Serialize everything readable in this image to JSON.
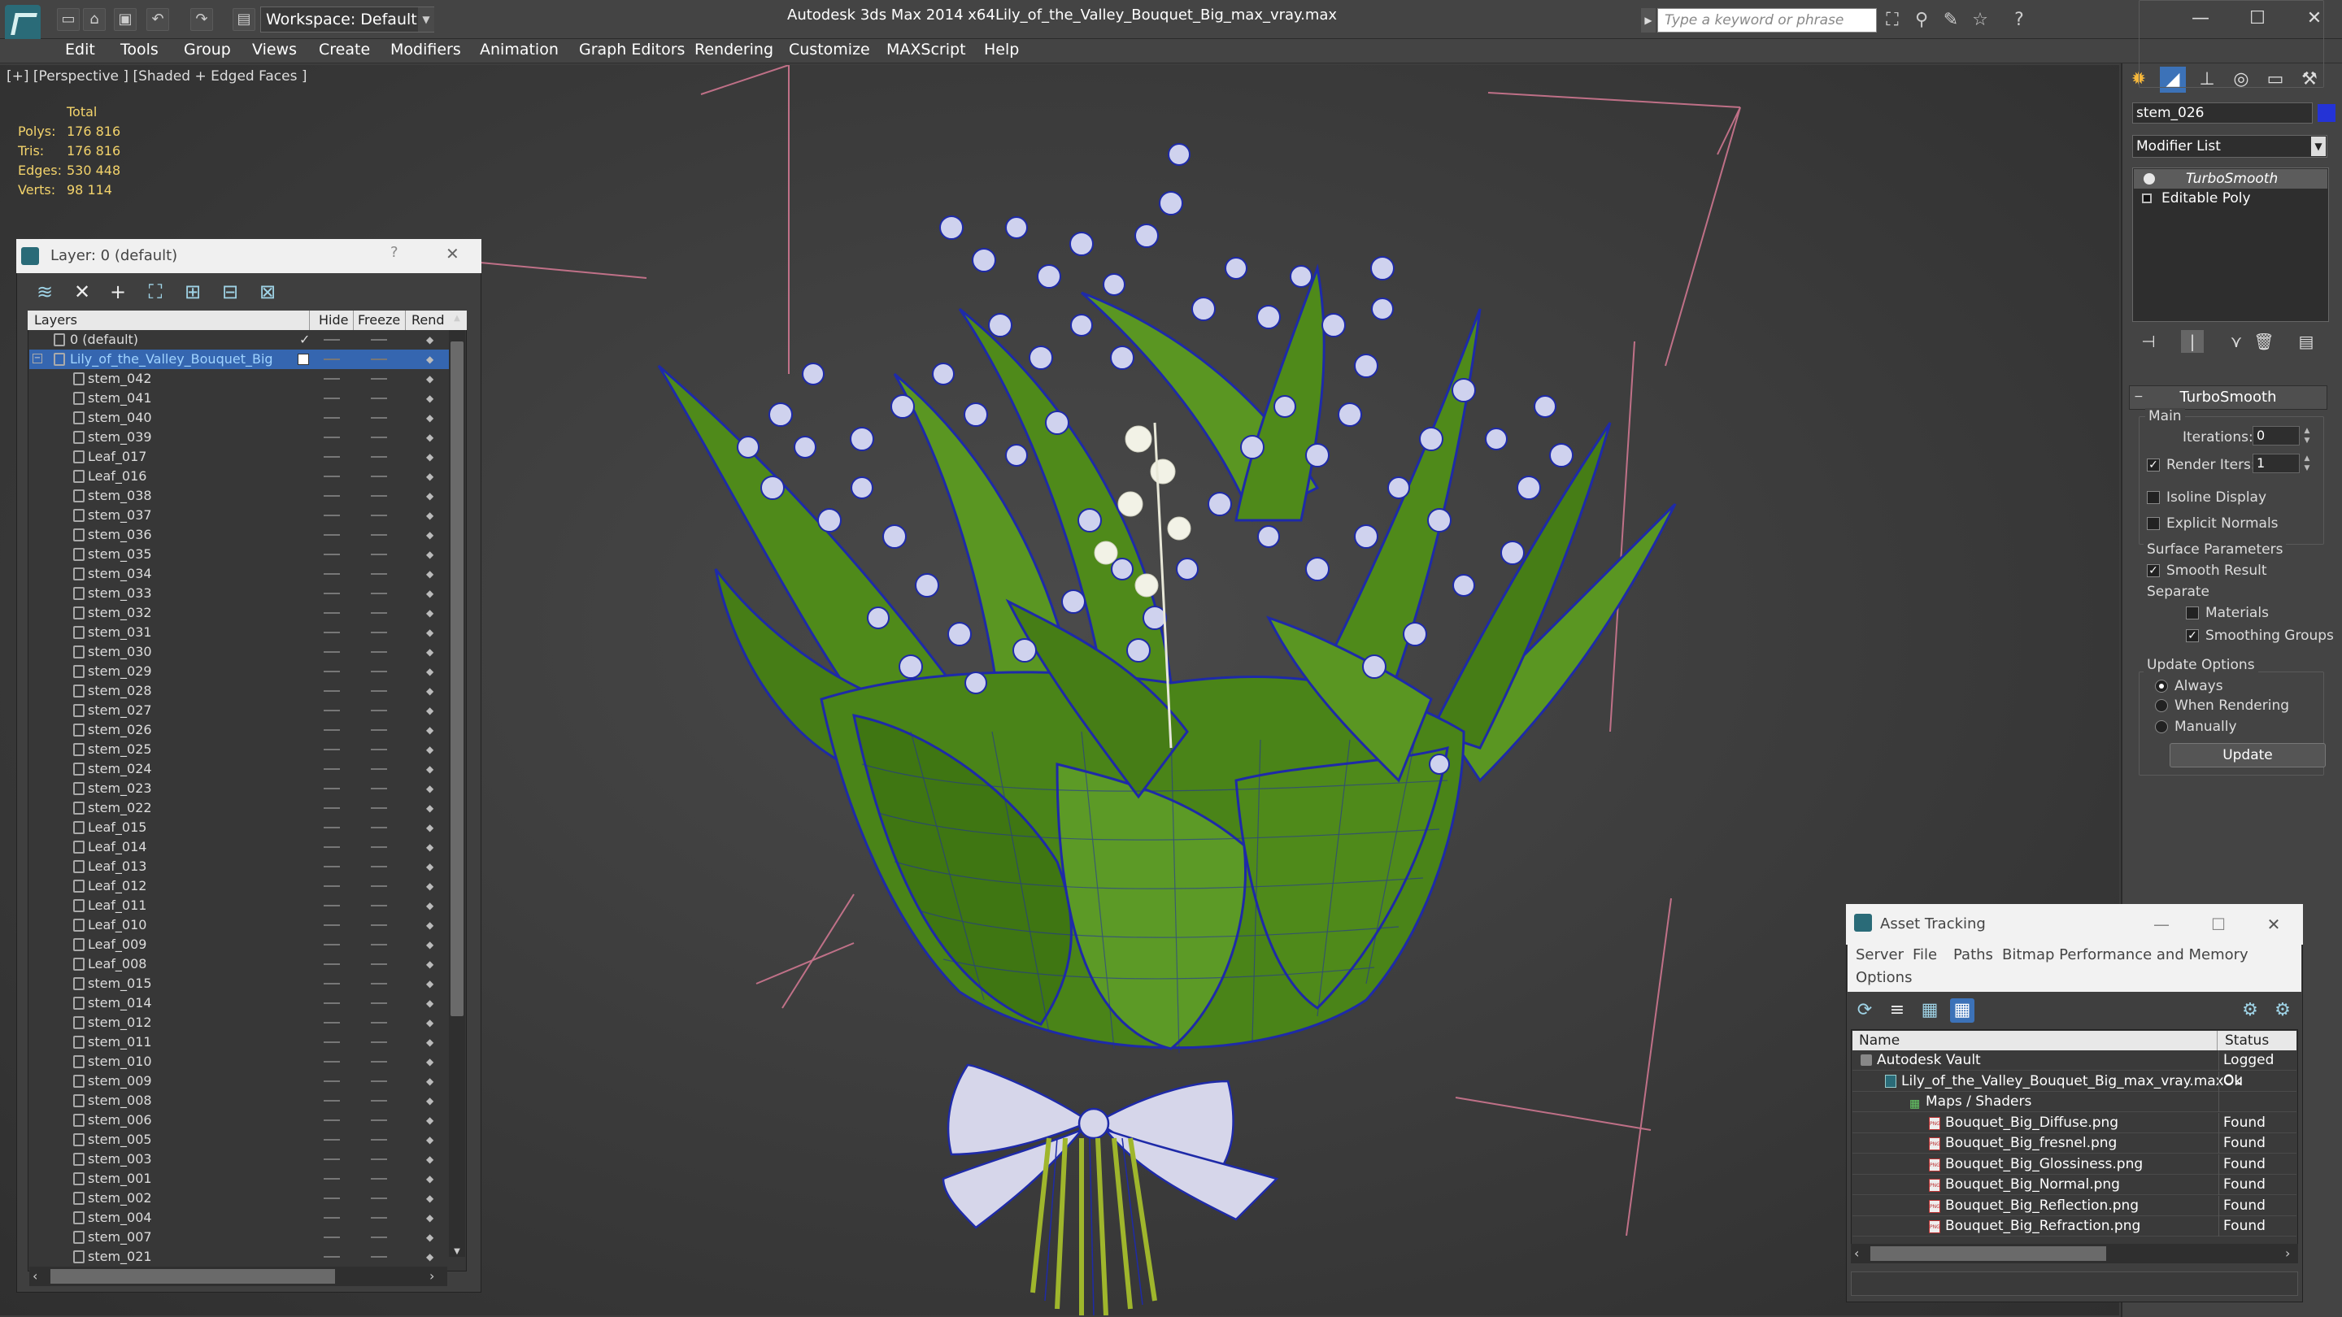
{
  "titlebar": {
    "workspace": "Workspace: Default",
    "app_title": "Autodesk 3ds Max  2014 x64",
    "file_title": "Lily_of_the_Valley_Bouquet_Big_max_vray.max",
    "search_placeholder": "Type a keyword or phrase"
  },
  "menubar": {
    "items": [
      "Edit",
      "Tools",
      "Group",
      "Views",
      "Create",
      "Modifiers",
      "Animation",
      "Graph Editors",
      "Rendering",
      "Customize",
      "MAXScript",
      "Help"
    ]
  },
  "viewport": {
    "label": "[+] [Perspective ] [Shaded + Edged Faces ]",
    "stats": {
      "header": "Total",
      "rows": [
        {
          "label": "Polys:",
          "value": "176 816"
        },
        {
          "label": "Tris:",
          "value": "176 816"
        },
        {
          "label": "Edges:",
          "value": "530 448"
        },
        {
          "label": "Verts:",
          "value": "98 114"
        }
      ]
    }
  },
  "layer_dialog": {
    "title": "Layer: 0 (default)",
    "help_glyph": "?",
    "close_glyph": "✕",
    "columns": [
      "Layers",
      "Hide",
      "Freeze",
      "Rend"
    ],
    "default_layer": "0 (default)",
    "selected_layer": "Lily_of_the_Valley_Bouquet_Big",
    "children": [
      "stem_042",
      "stem_041",
      "stem_040",
      "stem_039",
      "Leaf_017",
      "Leaf_016",
      "stem_038",
      "stem_037",
      "stem_036",
      "stem_035",
      "stem_034",
      "stem_033",
      "stem_032",
      "stem_031",
      "stem_030",
      "stem_029",
      "stem_028",
      "stem_027",
      "stem_026",
      "stem_025",
      "stem_024",
      "stem_023",
      "stem_022",
      "Leaf_015",
      "Leaf_014",
      "Leaf_013",
      "Leaf_012",
      "Leaf_011",
      "Leaf_010",
      "Leaf_009",
      "Leaf_008",
      "stem_015",
      "stem_014",
      "stem_012",
      "stem_011",
      "stem_010",
      "stem_009",
      "stem_008",
      "stem_006",
      "stem_005",
      "stem_003",
      "stem_001",
      "stem_002",
      "stem_004",
      "stem_007",
      "stem_021"
    ]
  },
  "command_panel": {
    "object_name": "stem_026",
    "object_color": "#2433d6",
    "modifier_list": "Modifier List",
    "stack": [
      "TurboSmooth",
      "Editable Poly"
    ],
    "turbosmooth": {
      "title": "TurboSmooth",
      "main": "Main",
      "iterations_label": "Iterations:",
      "iterations_value": "0",
      "render_iters_label": "Render Iters:",
      "render_iters_value": "1",
      "isoline_display": "Isoline Display",
      "explicit_normals": "Explicit Normals",
      "surface_parameters": "Surface Parameters",
      "smooth_result": "Smooth Result",
      "separate": "Separate",
      "materials": "Materials",
      "smoothing_groups": "Smoothing Groups",
      "update_options": "Update Options",
      "always": "Always",
      "when_rendering": "When Rendering",
      "manually": "Manually",
      "update_button": "Update"
    }
  },
  "asset_tracking": {
    "title": "Asset Tracking",
    "menu": [
      "Server",
      "File",
      "Paths",
      "Bitmap Performance and Memory",
      "Options"
    ],
    "columns": [
      "Name",
      "Status"
    ],
    "rows": [
      {
        "name": "Autodesk Vault",
        "status": "Logged Ou"
      },
      {
        "name": "Lily_of_the_Valley_Bouquet_Big_max_vray.max",
        "status": "Ok"
      },
      {
        "name": "Maps / Shaders",
        "status": ""
      },
      {
        "name": "Bouquet_Big_Diffuse.png",
        "status": "Found"
      },
      {
        "name": "Bouquet_Big_fresnel.png",
        "status": "Found"
      },
      {
        "name": "Bouquet_Big_Glossiness.png",
        "status": "Found"
      },
      {
        "name": "Bouquet_Big_Normal.png",
        "status": "Found"
      },
      {
        "name": "Bouquet_Big_Reflection.png",
        "status": "Found"
      },
      {
        "name": "Bouquet_Big_Refraction.png",
        "status": "Found"
      }
    ]
  },
  "colors": {
    "accent_blue": "#3c72b8",
    "stat_yellow": "#f3d36b",
    "wire_blue": "#1e2aa8",
    "leaf_green": "#4f8a1a"
  }
}
